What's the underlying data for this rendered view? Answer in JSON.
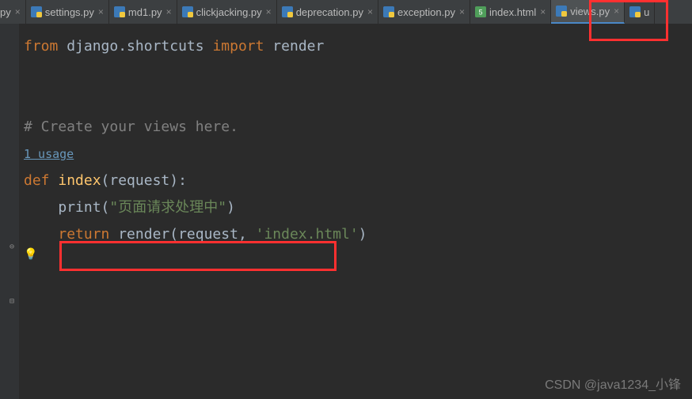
{
  "tabs": [
    {
      "label": "py",
      "type": "py",
      "partial": true
    },
    {
      "label": "settings.py",
      "type": "py"
    },
    {
      "label": "md1.py",
      "type": "py"
    },
    {
      "label": "clickjacking.py",
      "type": "py"
    },
    {
      "label": "deprecation.py",
      "type": "py"
    },
    {
      "label": "exception.py",
      "type": "py"
    },
    {
      "label": "index.html",
      "type": "html"
    },
    {
      "label": "views.py",
      "type": "py",
      "active": true
    },
    {
      "label": "u",
      "type": "py",
      "partial": true
    }
  ],
  "code": {
    "line1": {
      "from": "from",
      "mod": " django.shortcuts ",
      "import": "import",
      "name": " render"
    },
    "comment": "# Create your views here.",
    "usage": "1 usage",
    "def_kw": "def ",
    "def_name": "index",
    "def_params": "(request):",
    "print_fn": "print",
    "print_open": "(",
    "print_str": "\"页面请求处理中\"",
    "print_close": ")",
    "return_kw": "return ",
    "render_fn": "render",
    "render_args_open": "(request, ",
    "render_str": "'index.html'",
    "render_close": ")"
  },
  "watermark": "CSDN @java1234_小锋"
}
